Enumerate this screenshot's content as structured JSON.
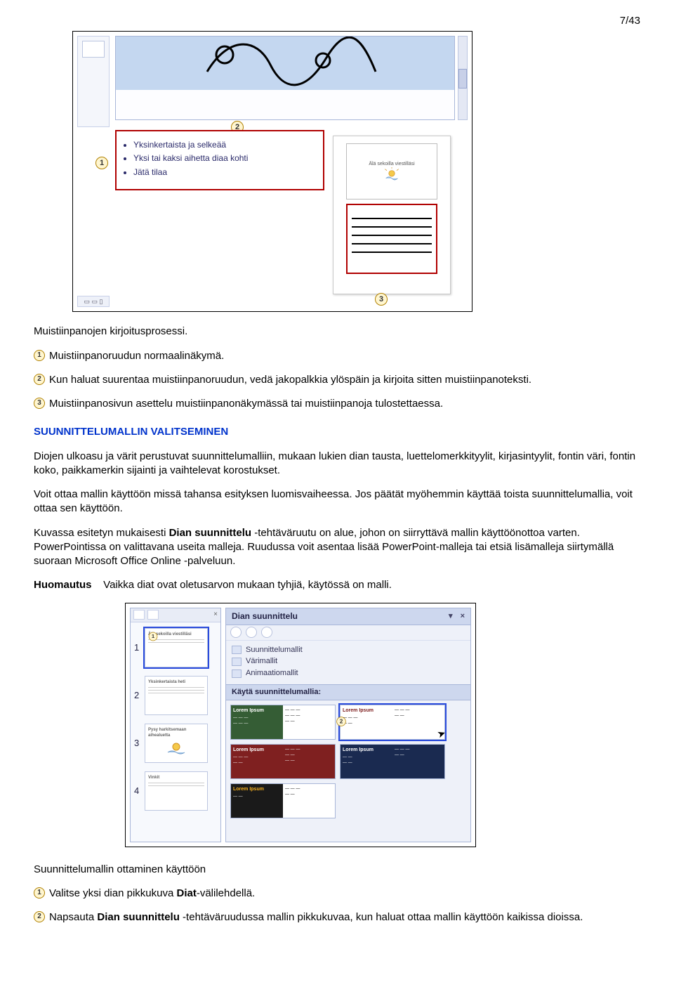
{
  "pageNumber": "7/43",
  "figure1": {
    "callouts": {
      "c1": "1",
      "c2": "2",
      "c3": "3"
    },
    "outline": {
      "b1": "Yksinkertaista ja selkeää",
      "b2": "Yksi tai kaksi aihetta diaa kohti",
      "b3": "Jätä tilaa"
    },
    "notesSlideTitle": "Älä sekoilla viestilläsi"
  },
  "intro": {
    "heading": "Muistiinpanojen kirjoitusprosessi.",
    "items": {
      "i1": "Muistiinpanoruudun normaalinäkymä.",
      "i2": "Kun haluat suurentaa muistiinpanoruudun, vedä jakopalkkia ylöspäin ja kirjoita sitten muistiinpanoteksti.",
      "i3": "Muistiinpanosivun asettelu muistiinpanonäkymässä tai muistiinpanoja tulostettaessa."
    }
  },
  "section": {
    "title": "SUUNNITTELUMALLIN VALITSEMINEN",
    "p1": "Diojen ulkoasu ja värit perustuvat suunnittelumalliin, mukaan lukien dian tausta, luettelomerkkityylit, kirjasintyylit, fontin väri, fontin koko, paikkamerkin sijainti ja vaihtelevat korostukset.",
    "p2": "Voit ottaa mallin käyttöön missä tahansa esityksen luomisvaiheessa. Jos päätät myöhemmin käyttää toista suunnittelumallia, voit ottaa sen käyttöön.",
    "p3a": "Kuvassa esitetyn mukaisesti ",
    "p3bold": "Dian suunnittelu",
    "p3b": " -tehtäväruutu on alue, johon on siirryttävä mallin käyttöönottoa varten. PowerPointissa on valittavana useita malleja. Ruudussa voit asentaa lisää PowerPoint-malleja tai etsiä lisämalleja siirtymällä suoraan Microsoft Office Online -palveluun.",
    "noteLabel": "Huomautus",
    "noteText": "Vaikka diat ovat oletusarvon mukaan tyhjiä, käytössä on malli."
  },
  "figure2": {
    "callouts": {
      "left1": "1",
      "rightCursor": "2"
    },
    "slideNumbers": {
      "s1": "1",
      "s2": "2",
      "s3": "3",
      "s4": "4"
    },
    "slideTitles": {
      "t1": "Älä sekoilla viestilläsi",
      "t2": "Yksinkertaista heti",
      "t3": "Pysy harkitsemaan aihealuetta",
      "t4": "Vinkit"
    },
    "paneTitle": "Dian suunnittelu",
    "links": {
      "l1": "Suunnittelumallit",
      "l2": "Värimallit",
      "l3": "Animaatiomallit"
    },
    "sectionLabel": "Käytä suunnittelumallia:",
    "tmplTitle": "Lorem Ipsum"
  },
  "closing": {
    "heading": "Suunnittelumallin ottaminen käyttöön",
    "i1a": "Valitse yksi dian pikkukuva ",
    "i1bold": "Diat",
    "i1b": "-välilehdellä.",
    "i2a": "Napsauta ",
    "i2bold": "Dian suunnittelu",
    "i2b": " -tehtäväruudussa mallin pikkukuvaa, kun haluat ottaa mallin käyttöön kaikissa dioissa."
  }
}
